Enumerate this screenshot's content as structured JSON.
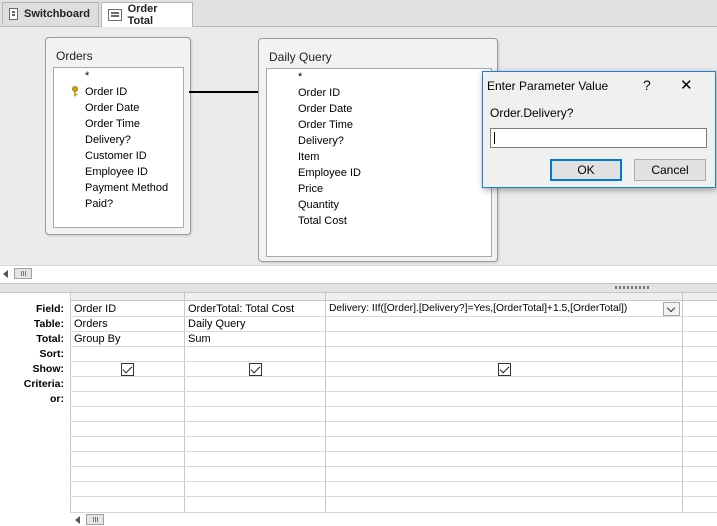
{
  "tabs": [
    {
      "label": "Switchboard",
      "icon": "form-icon"
    },
    {
      "label": "Order Total",
      "icon": "query-icon"
    }
  ],
  "tables": {
    "orders": {
      "title": "Orders",
      "fields": [
        "*",
        "Order ID",
        "Order Date",
        "Order Time",
        "Delivery?",
        "Customer ID",
        "Employee ID",
        "Payment Method",
        "Paid?"
      ]
    },
    "daily_query": {
      "title": "Daily Query",
      "fields": [
        "*",
        "Order ID",
        "Order Date",
        "Order Time",
        "Delivery?",
        "Item",
        "Employee ID",
        "Price",
        "Quantity",
        "Total Cost"
      ]
    }
  },
  "grid": {
    "row_labels": [
      "Field:",
      "Table:",
      "Total:",
      "Sort:",
      "Show:",
      "Criteria:",
      "or:"
    ],
    "columns": [
      {
        "field": "Order ID",
        "table": "Orders",
        "total": "Group By",
        "sort": "",
        "show": true
      },
      {
        "field": "OrderTotal: Total Cost",
        "table": "Daily Query",
        "total": "Sum",
        "sort": "",
        "show": true
      },
      {
        "field": "Delivery: IIf([Order].[Delivery?]=Yes,[OrderTotal]+1.5,[OrderTotal])",
        "table": "",
        "total": "",
        "sort": "",
        "show": true
      }
    ]
  },
  "dialog": {
    "title": "Enter Parameter Value",
    "help": "?",
    "close": "✕",
    "prompt": "Order.Delivery?",
    "value": "",
    "ok": "OK",
    "cancel": "Cancel"
  }
}
